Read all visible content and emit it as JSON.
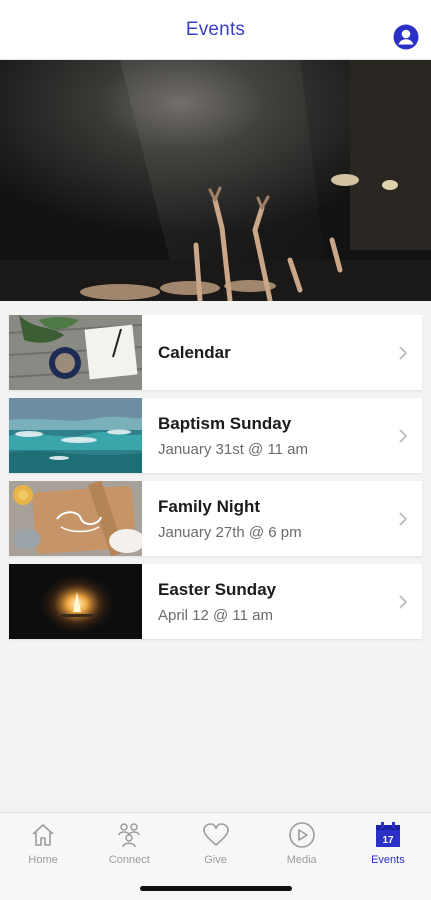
{
  "header": {
    "title": "Events",
    "profile_icon": "person-circle-icon",
    "accent_color": "#3b3fc4"
  },
  "hero": {
    "image": "worship-concert-hands-raised"
  },
  "events": [
    {
      "title": "Calendar",
      "subtitle": "",
      "thumb": "desk-notebook-coffee-plant"
    },
    {
      "title": "Baptism Sunday",
      "subtitle": "January 31st @ 11 am",
      "thumb": "ocean-waves"
    },
    {
      "title": "Family Night",
      "subtitle": "January 27th @ 6 pm",
      "thumb": "baking-board-family"
    },
    {
      "title": "Easter Sunday",
      "subtitle": "April 12 @ 11 am",
      "thumb": "campfire-dark"
    }
  ],
  "tabbar": {
    "tabs": [
      {
        "label": "Home",
        "icon": "home-icon",
        "active": false
      },
      {
        "label": "Connect",
        "icon": "people-icon",
        "active": false
      },
      {
        "label": "Give",
        "icon": "heart-icon",
        "active": false
      },
      {
        "label": "Media",
        "icon": "play-circle-icon",
        "active": false
      },
      {
        "label": "Events",
        "icon": "calendar-icon",
        "active": true
      }
    ],
    "calendar_day": "17",
    "active_color": "#2b31c6",
    "inactive_color": "#9c9c9c"
  }
}
